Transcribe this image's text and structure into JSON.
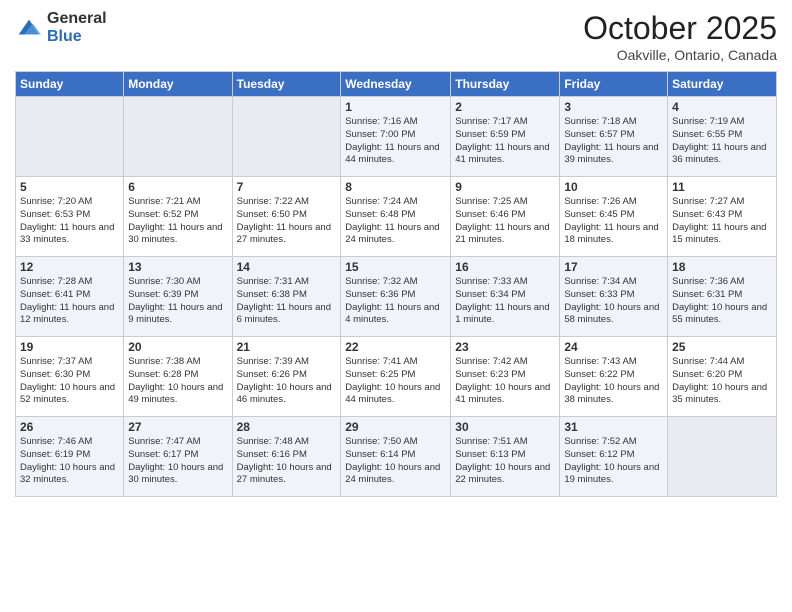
{
  "header": {
    "logo_general": "General",
    "logo_blue": "Blue",
    "month_title": "October 2025",
    "subtitle": "Oakville, Ontario, Canada"
  },
  "calendar": {
    "days_of_week": [
      "Sunday",
      "Monday",
      "Tuesday",
      "Wednesday",
      "Thursday",
      "Friday",
      "Saturday"
    ],
    "weeks": [
      {
        "row_class": "row-odd",
        "days": [
          {
            "num": "",
            "info": "",
            "empty": true
          },
          {
            "num": "",
            "info": "",
            "empty": true
          },
          {
            "num": "",
            "info": "",
            "empty": true
          },
          {
            "num": "1",
            "info": "Sunrise: 7:16 AM\nSunset: 7:00 PM\nDaylight: 11 hours\nand 44 minutes.",
            "empty": false
          },
          {
            "num": "2",
            "info": "Sunrise: 7:17 AM\nSunset: 6:59 PM\nDaylight: 11 hours\nand 41 minutes.",
            "empty": false
          },
          {
            "num": "3",
            "info": "Sunrise: 7:18 AM\nSunset: 6:57 PM\nDaylight: 11 hours\nand 39 minutes.",
            "empty": false
          },
          {
            "num": "4",
            "info": "Sunrise: 7:19 AM\nSunset: 6:55 PM\nDaylight: 11 hours\nand 36 minutes.",
            "empty": false
          }
        ]
      },
      {
        "row_class": "row-even",
        "days": [
          {
            "num": "5",
            "info": "Sunrise: 7:20 AM\nSunset: 6:53 PM\nDaylight: 11 hours\nand 33 minutes.",
            "empty": false
          },
          {
            "num": "6",
            "info": "Sunrise: 7:21 AM\nSunset: 6:52 PM\nDaylight: 11 hours\nand 30 minutes.",
            "empty": false
          },
          {
            "num": "7",
            "info": "Sunrise: 7:22 AM\nSunset: 6:50 PM\nDaylight: 11 hours\nand 27 minutes.",
            "empty": false
          },
          {
            "num": "8",
            "info": "Sunrise: 7:24 AM\nSunset: 6:48 PM\nDaylight: 11 hours\nand 24 minutes.",
            "empty": false
          },
          {
            "num": "9",
            "info": "Sunrise: 7:25 AM\nSunset: 6:46 PM\nDaylight: 11 hours\nand 21 minutes.",
            "empty": false
          },
          {
            "num": "10",
            "info": "Sunrise: 7:26 AM\nSunset: 6:45 PM\nDaylight: 11 hours\nand 18 minutes.",
            "empty": false
          },
          {
            "num": "11",
            "info": "Sunrise: 7:27 AM\nSunset: 6:43 PM\nDaylight: 11 hours\nand 15 minutes.",
            "empty": false
          }
        ]
      },
      {
        "row_class": "row-odd",
        "days": [
          {
            "num": "12",
            "info": "Sunrise: 7:28 AM\nSunset: 6:41 PM\nDaylight: 11 hours\nand 12 minutes.",
            "empty": false
          },
          {
            "num": "13",
            "info": "Sunrise: 7:30 AM\nSunset: 6:39 PM\nDaylight: 11 hours\nand 9 minutes.",
            "empty": false
          },
          {
            "num": "14",
            "info": "Sunrise: 7:31 AM\nSunset: 6:38 PM\nDaylight: 11 hours\nand 6 minutes.",
            "empty": false
          },
          {
            "num": "15",
            "info": "Sunrise: 7:32 AM\nSunset: 6:36 PM\nDaylight: 11 hours\nand 4 minutes.",
            "empty": false
          },
          {
            "num": "16",
            "info": "Sunrise: 7:33 AM\nSunset: 6:34 PM\nDaylight: 11 hours\nand 1 minute.",
            "empty": false
          },
          {
            "num": "17",
            "info": "Sunrise: 7:34 AM\nSunset: 6:33 PM\nDaylight: 10 hours\nand 58 minutes.",
            "empty": false
          },
          {
            "num": "18",
            "info": "Sunrise: 7:36 AM\nSunset: 6:31 PM\nDaylight: 10 hours\nand 55 minutes.",
            "empty": false
          }
        ]
      },
      {
        "row_class": "row-even",
        "days": [
          {
            "num": "19",
            "info": "Sunrise: 7:37 AM\nSunset: 6:30 PM\nDaylight: 10 hours\nand 52 minutes.",
            "empty": false
          },
          {
            "num": "20",
            "info": "Sunrise: 7:38 AM\nSunset: 6:28 PM\nDaylight: 10 hours\nand 49 minutes.",
            "empty": false
          },
          {
            "num": "21",
            "info": "Sunrise: 7:39 AM\nSunset: 6:26 PM\nDaylight: 10 hours\nand 46 minutes.",
            "empty": false
          },
          {
            "num": "22",
            "info": "Sunrise: 7:41 AM\nSunset: 6:25 PM\nDaylight: 10 hours\nand 44 minutes.",
            "empty": false
          },
          {
            "num": "23",
            "info": "Sunrise: 7:42 AM\nSunset: 6:23 PM\nDaylight: 10 hours\nand 41 minutes.",
            "empty": false
          },
          {
            "num": "24",
            "info": "Sunrise: 7:43 AM\nSunset: 6:22 PM\nDaylight: 10 hours\nand 38 minutes.",
            "empty": false
          },
          {
            "num": "25",
            "info": "Sunrise: 7:44 AM\nSunset: 6:20 PM\nDaylight: 10 hours\nand 35 minutes.",
            "empty": false
          }
        ]
      },
      {
        "row_class": "row-odd",
        "days": [
          {
            "num": "26",
            "info": "Sunrise: 7:46 AM\nSunset: 6:19 PM\nDaylight: 10 hours\nand 32 minutes.",
            "empty": false
          },
          {
            "num": "27",
            "info": "Sunrise: 7:47 AM\nSunset: 6:17 PM\nDaylight: 10 hours\nand 30 minutes.",
            "empty": false
          },
          {
            "num": "28",
            "info": "Sunrise: 7:48 AM\nSunset: 6:16 PM\nDaylight: 10 hours\nand 27 minutes.",
            "empty": false
          },
          {
            "num": "29",
            "info": "Sunrise: 7:50 AM\nSunset: 6:14 PM\nDaylight: 10 hours\nand 24 minutes.",
            "empty": false
          },
          {
            "num": "30",
            "info": "Sunrise: 7:51 AM\nSunset: 6:13 PM\nDaylight: 10 hours\nand 22 minutes.",
            "empty": false
          },
          {
            "num": "31",
            "info": "Sunrise: 7:52 AM\nSunset: 6:12 PM\nDaylight: 10 hours\nand 19 minutes.",
            "empty": false
          },
          {
            "num": "",
            "info": "",
            "empty": true
          }
        ]
      }
    ]
  }
}
